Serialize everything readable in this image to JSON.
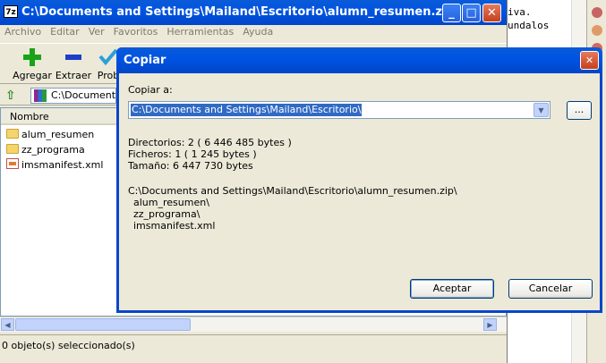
{
  "main_window": {
    "title": "C:\\Documents and Settings\\Mailand\\Escritorio\\alumn_resumen.zip\\",
    "app_icon_text": "7z",
    "menu": [
      "Archivo",
      "Editar",
      "Ver",
      "Favoritos",
      "Herramientas",
      "Ayuda"
    ],
    "toolbar": [
      {
        "label": "Agregar",
        "icon": "plus-icon",
        "color": "#1aa31a"
      },
      {
        "label": "Extraer",
        "icon": "minus-icon",
        "color": "#1c3fc7"
      },
      {
        "label": "Prob",
        "icon": "check-icon",
        "color": "#2aa0d8"
      }
    ],
    "address": "C:\\Documents a",
    "column_header": "Nombre",
    "files": [
      {
        "name": "alum_resumen",
        "type": "folder"
      },
      {
        "name": "zz_programa",
        "type": "folder"
      },
      {
        "name": "imsmanifest.xml",
        "type": "xml"
      }
    ],
    "status": "0 objeto(s) seleccionado(s)"
  },
  "background_editor": {
    "lines": [
      "",
      "iva.",
      "undalos",
      ""
    ]
  },
  "dialog": {
    "title": "Copiar",
    "copy_to_label": "Copiar a:",
    "destination": "C:\\Documents and Settings\\Mailand\\Escritorio\\",
    "browse_label": "...",
    "stats": {
      "directories": "Directorios: 2    ( 6 446 485 bytes )",
      "files": "Ficheros: 1     ( 1 245 bytes )",
      "size": "Tamaño: 6 447 730 bytes"
    },
    "source_path": "C:\\Documents and Settings\\Mailand\\Escritorio\\alumn_resumen.zip\\",
    "items": [
      "alum_resumen\\",
      "zz_programa\\",
      "imsmanifest.xml"
    ],
    "accept_label": "Aceptar",
    "cancel_label": "Cancelar"
  },
  "colors": {
    "titlebar": "#0054e3",
    "window_bg": "#ece9d8",
    "selection": "#316ac5"
  }
}
